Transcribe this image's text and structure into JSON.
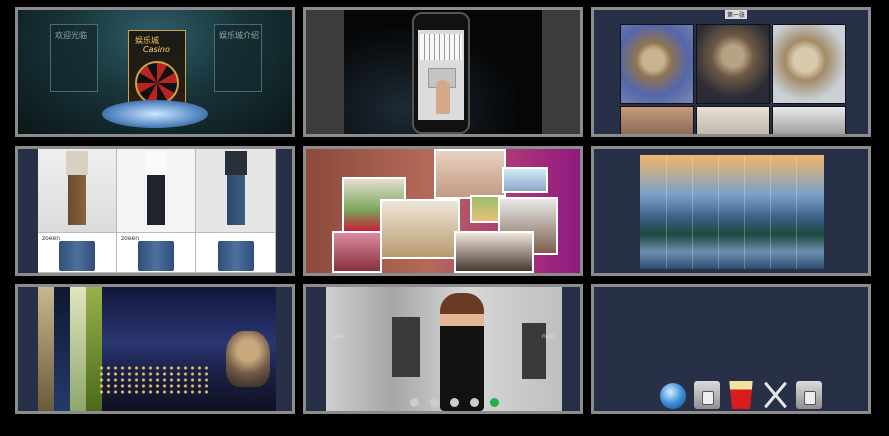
{
  "tile1": {
    "left_label": "欢迎光临",
    "brand_label": "娱乐城",
    "brand_subtitle": "Casino",
    "right_label": "娱乐城介绍"
  },
  "tile3": {
    "chip_label": "第一张"
  },
  "tile4": {
    "item_labels": [
      "zoeen",
      "zoeen"
    ]
  },
  "tile8": {
    "prev_label": "prev",
    "next_label": "next",
    "slide_count": 5,
    "active_slide": 5
  },
  "tile9": {
    "dock_icons": [
      "safari-icon",
      "folder-icon",
      "popcorn-icon",
      "tools-icon",
      "folder-icon"
    ]
  },
  "colors": {
    "frame": "#8c8c8c",
    "panel": "#273047",
    "active_dot": "#22b14c"
  }
}
